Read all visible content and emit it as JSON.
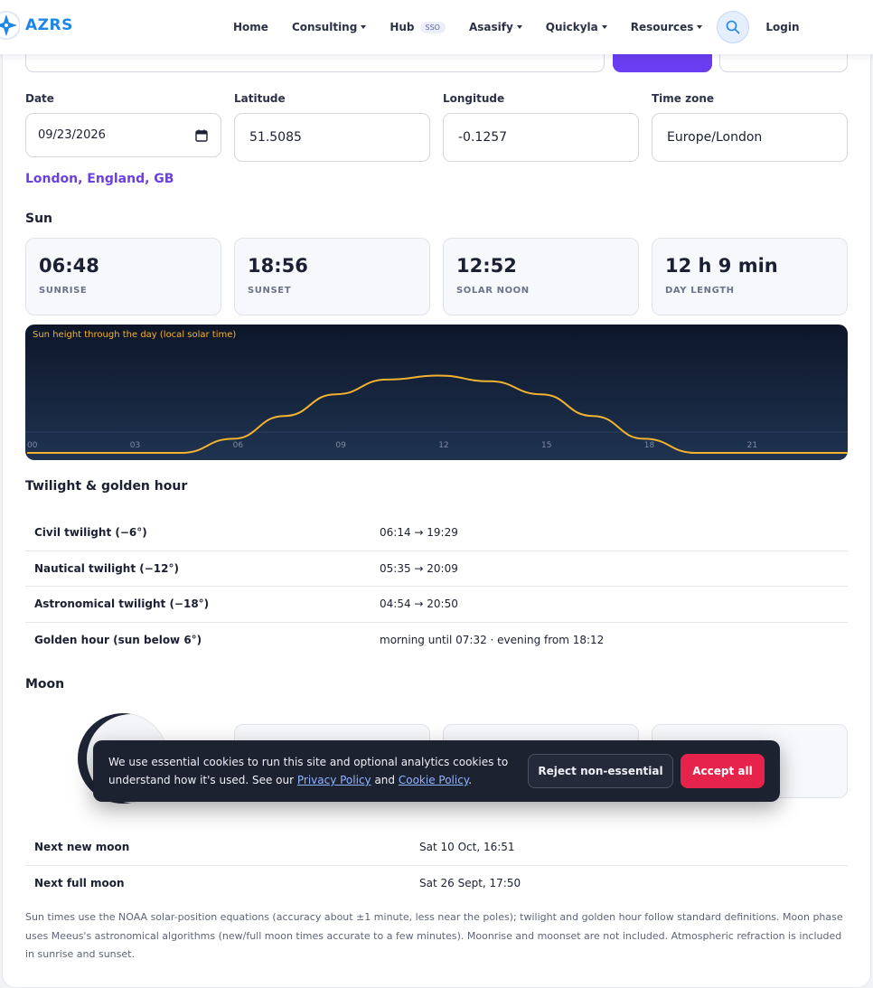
{
  "header": {
    "logo_text": "AZRS",
    "nav": [
      {
        "label": "Home",
        "caret": false
      },
      {
        "label": "Consulting",
        "caret": true
      },
      {
        "label": "Hub",
        "caret": false,
        "badge": "SSO"
      },
      {
        "label": "Asasify",
        "caret": true
      },
      {
        "label": "Quickyla",
        "caret": true
      },
      {
        "label": "Resources",
        "caret": true
      }
    ],
    "login_label": "Login"
  },
  "form": {
    "date_label": "Date",
    "date_value": "09/23/2026",
    "latitude_label": "Latitude",
    "latitude_value": "51.5085",
    "longitude_label": "Longitude",
    "longitude_value": "-0.1257",
    "timezone_label": "Time zone",
    "timezone_value": "Europe/London"
  },
  "place": "London, England, GB",
  "sun": {
    "title": "Sun",
    "stats": [
      {
        "value": "06:48",
        "label": "SUNRISE"
      },
      {
        "value": "18:56",
        "label": "SUNSET"
      },
      {
        "value": "12:52",
        "label": "SOLAR NOON"
      },
      {
        "value": "12 h 9 min",
        "label": "DAY LENGTH"
      }
    ]
  },
  "chart_data": {
    "type": "line",
    "title": "Sun height through the day (local solar time)",
    "x_ticks": [
      "00",
      "03",
      "06",
      "09",
      "12",
      "15",
      "18",
      "21"
    ],
    "xlim": [
      0,
      24
    ],
    "series": [
      {
        "x": [
          0,
          3,
          4.5,
          6,
          7.5,
          9,
          10.5,
          12,
          13.5,
          15,
          16.5,
          18,
          19.5,
          21,
          24
        ],
        "y": [
          0,
          0,
          0,
          6.5,
          17,
          27,
          33.8,
          35.6,
          33,
          27,
          17,
          6.5,
          0,
          0,
          0
        ],
        "color": "#f2b230"
      }
    ],
    "ylim": [
      0,
      55
    ],
    "grid": false,
    "background": [
      "#0d1629",
      "#1f3350"
    ]
  },
  "twilight": {
    "title": "Twilight & golden hour",
    "rows": [
      {
        "name": "Civil twilight (−6°)",
        "value": "06:14 → 19:29"
      },
      {
        "name": "Nautical twilight (−12°)",
        "value": "05:35 → 20:09"
      },
      {
        "name": "Astronomical twilight (−18°)",
        "value": "04:54 → 20:50"
      },
      {
        "name": "Golden hour (sun below 6°)",
        "value": "morning until 07:32 · evening from 18:12"
      }
    ]
  },
  "moon": {
    "title": "Moon",
    "rows": [
      {
        "name": "Next new moon",
        "value": "Sat 10 Oct, 16:51"
      },
      {
        "name": "Next full moon",
        "value": "Sat 26 Sept, 17:50"
      }
    ]
  },
  "footnote": "Sun times use the NOAA solar-position equations (accuracy about ±1 minute, less near the poles); twilight and golden hour follow standard definitions. Moon phase uses Meeus's astronomical algorithms (new/full moon times accurate to a few minutes). Moonrise and moonset are not included. Atmospheric refraction is included in sunrise and sunset.",
  "cookie": {
    "text_before": "We use essential cookies to run this site and optional analytics cookies to understand how it's used. See our ",
    "privacy_link": "Privacy Policy",
    "text_and": " and ",
    "cookie_link": "Cookie Policy",
    "text_after": ".",
    "reject_label": "Reject non-essential",
    "accept_label": "Accept all"
  },
  "colors": {
    "accent": "#6a3df0",
    "place": "#6b3fe0",
    "accept": "#e5234b",
    "sun_line": "#f2b230"
  }
}
